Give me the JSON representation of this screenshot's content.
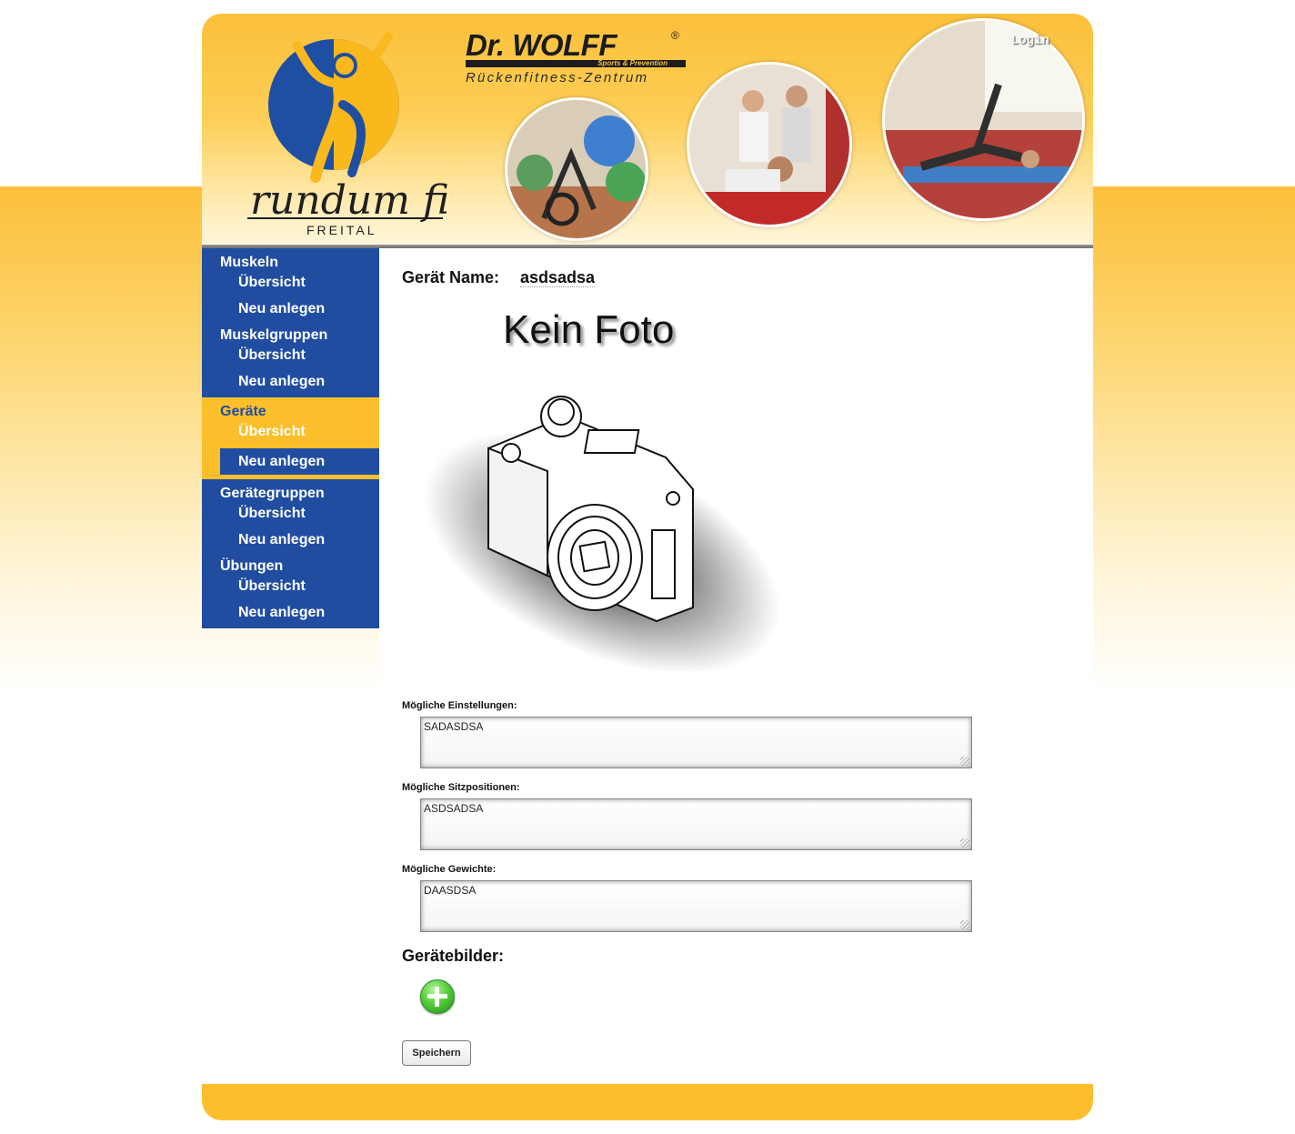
{
  "header": {
    "logo_text": "rundum fit",
    "logo_sub": "FREITAL",
    "brand_name": "Dr. WOLFF",
    "brand_reg": "®",
    "brand_tagline": "Sports & Prevention",
    "brand_sub": "Rückenfitness-Zentrum",
    "login_label": "Login"
  },
  "sidebar": {
    "groups": [
      {
        "title": "Muskeln",
        "items": [
          "Übersicht",
          "Neu anlegen"
        ]
      },
      {
        "title": "Muskelgruppen",
        "items": [
          "Übersicht",
          "Neu anlegen"
        ]
      },
      {
        "title": "Geräte",
        "items": [
          "Übersicht",
          "Neu anlegen"
        ]
      },
      {
        "title": "Gerätegruppen",
        "items": [
          "Übersicht",
          "Neu anlegen"
        ]
      },
      {
        "title": "Übungen",
        "items": [
          "Übersicht",
          "Neu anlegen"
        ]
      }
    ],
    "active_group": "Geräte",
    "selected_item": "Neu anlegen"
  },
  "main": {
    "name_label": "Gerät Name:",
    "name_value": "asdsadsa",
    "photo_text": "Kein Foto",
    "fields": [
      {
        "label": "Mögliche Einstellungen:",
        "value": "SADASDSA"
      },
      {
        "label": "Mögliche Sitzpositionen:",
        "value": "ASDSADSA"
      },
      {
        "label": "Mögliche Gewichte:",
        "value": "DAASDSA"
      }
    ],
    "images_title": "Gerätebilder:",
    "save_label": "Speichern"
  },
  "colors": {
    "nav_blue": "#214da1",
    "accent_yellow": "#fbbf2b"
  }
}
